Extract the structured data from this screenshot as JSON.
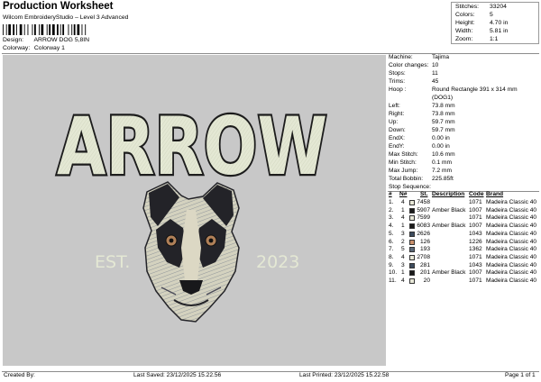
{
  "header": {
    "title": "Production Worksheet",
    "subtitle": "Wilcom EmbroideryStudio – Level 3 Advanced",
    "design_label": "Design:",
    "design_value": "ARROW DOG 5,8IN",
    "colorway_label": "Colorway:",
    "colorway_value": "Colorway 1"
  },
  "stats": [
    {
      "label": "Stitches:",
      "value": "33204"
    },
    {
      "label": "Colors:",
      "value": "5"
    },
    {
      "label": "Height:",
      "value": "4.70 in"
    },
    {
      "label": "Width:",
      "value": "5.81 in"
    },
    {
      "label": "Zoom:",
      "value": "1:1"
    }
  ],
  "design": {
    "word": "ARROW",
    "left_text": "EST.",
    "right_text": "2023",
    "colors": {
      "background": "#c8c8c8",
      "fill": "#e4e8d4",
      "outline": "#1c1c1c",
      "dog_dark": "#232328",
      "dog_mid": "#4b4b58",
      "dog_light": "#dcd8c4",
      "tan": "#b08058"
    }
  },
  "machine_info": [
    {
      "label": "Machine:",
      "value": "Tajima"
    },
    {
      "label": "Color changes:",
      "value": "10"
    },
    {
      "label": "Stops:",
      "value": "11"
    },
    {
      "label": "Trims:",
      "value": "45"
    },
    {
      "label": "Hoop :",
      "value": "Round Rectangle 391 x 314 mm"
    },
    {
      "label": "",
      "value": "(DOG1)"
    },
    {
      "label": "Left:",
      "value": "73.8 mm"
    },
    {
      "label": "Right:",
      "value": "73.8 mm"
    },
    {
      "label": "Up:",
      "value": "59.7 mm"
    },
    {
      "label": "Down:",
      "value": "59.7 mm"
    },
    {
      "label": "EndX:",
      "value": "0.00 in"
    },
    {
      "label": "EndY:",
      "value": "0.00 in"
    },
    {
      "label": "Max Stitch:",
      "value": "10.6 mm"
    },
    {
      "label": "Min Stitch:",
      "value": "0.1 mm"
    },
    {
      "label": "Max Jump:",
      "value": "7.2 mm"
    },
    {
      "label": "Total Bobbin:",
      "value": "225.85ft"
    }
  ],
  "stop_sequence": {
    "title": "Stop Sequence:",
    "headers": {
      "num": "#",
      "n": "N#",
      "st": "St.",
      "description": "Description",
      "code": "Code",
      "brand": "Brand"
    },
    "rows": [
      {
        "num": "1.",
        "n": "4",
        "color": "#e8e8d8",
        "st": "7458",
        "description": "",
        "code": "1071",
        "brand": "Madeira Classic 40"
      },
      {
        "num": "2.",
        "n": "1",
        "color": "#1a1a1a",
        "st": "5907",
        "description": "Amber Black",
        "code": "1007",
        "brand": "Madeira Classic 40"
      },
      {
        "num": "3.",
        "n": "4",
        "color": "#e8e8d8",
        "st": "7599",
        "description": "",
        "code": "1071",
        "brand": "Madeira Classic 40"
      },
      {
        "num": "4.",
        "n": "1",
        "color": "#1a1a1a",
        "st": "6083",
        "description": "Amber Black",
        "code": "1007",
        "brand": "Madeira Classic 40"
      },
      {
        "num": "5.",
        "n": "3",
        "color": "#3c4b5e",
        "st": "2626",
        "description": "",
        "code": "1043",
        "brand": "Madeira Classic 40"
      },
      {
        "num": "6.",
        "n": "2",
        "color": "#c8906c",
        "st": "126",
        "description": "",
        "code": "1226",
        "brand": "Madeira Classic 40"
      },
      {
        "num": "7.",
        "n": "5",
        "color": "#5a6878",
        "st": "193",
        "description": "",
        "code": "1362",
        "brand": "Madeira Classic 40"
      },
      {
        "num": "8.",
        "n": "4",
        "color": "#e8e8d8",
        "st": "2708",
        "description": "",
        "code": "1071",
        "brand": "Madeira Classic 40"
      },
      {
        "num": "9.",
        "n": "3",
        "color": "#3c4b5e",
        "st": "281",
        "description": "",
        "code": "1043",
        "brand": "Madeira Classic 40"
      },
      {
        "num": "10.",
        "n": "1",
        "color": "#1a1a1a",
        "st": "201",
        "description": "Amber Black",
        "code": "1007",
        "brand": "Madeira Classic 40"
      },
      {
        "num": "11.",
        "n": "4",
        "color": "#e8e8d8",
        "st": "20",
        "description": "",
        "code": "1071",
        "brand": "Madeira Classic 40"
      }
    ]
  },
  "footer": {
    "created_by": "Created By:",
    "last_saved": "Last Saved: 23/12/2025 15.22.56",
    "last_printed": "Last Printed: 23/12/2025 15.22.58",
    "page": "Page 1 of 1"
  }
}
